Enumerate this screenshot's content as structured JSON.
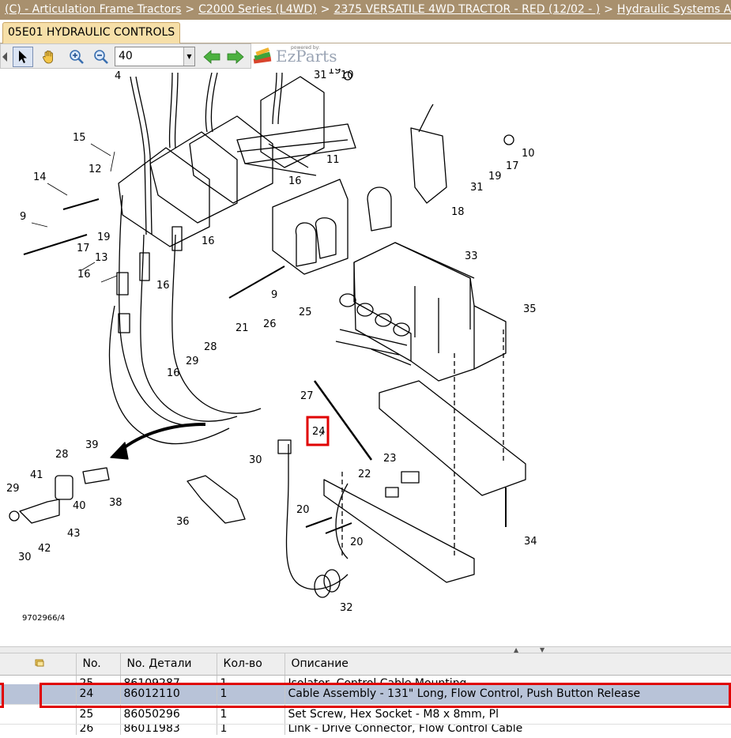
{
  "breadcrumb": {
    "items": [
      "(C) - Articulation Frame Tractors",
      "C2000 Series (L4WD)",
      "2375 VERSATILE 4WD TRACTOR - RED (12/02 - )",
      "Hydraulic Systems A"
    ],
    "separator": ">"
  },
  "tab": {
    "label": "05E01 HYDRAULIC CONTROLS"
  },
  "toolbar": {
    "zoom_value": "40",
    "buttons": [
      "scroll-left-icon",
      "select-arrow-icon",
      "pan-hand-icon",
      "zoom-in-icon",
      "zoom-out-icon",
      "back-arrow-icon",
      "forward-arrow-icon"
    ],
    "brand": "EzParts",
    "brand_small": "powered by:",
    "accent_green": "#3ea23a",
    "brand_color": "#9aa4b4"
  },
  "diagram": {
    "drawing_number": "9702966/4",
    "callouts": [
      "4",
      "10",
      "19",
      "31",
      "10",
      "11",
      "16",
      "12",
      "15",
      "14",
      "9",
      "19",
      "17",
      "13",
      "16",
      "16",
      "18",
      "19",
      "17",
      "31",
      "10",
      "16",
      "9",
      "21",
      "26",
      "25",
      "28",
      "29",
      "16",
      "27",
      "24",
      "33",
      "35",
      "39",
      "28",
      "41",
      "29",
      "40",
      "38",
      "36",
      "30",
      "30",
      "42",
      "43",
      "22",
      "23",
      "20",
      "20",
      "34",
      "32"
    ],
    "highlight_callout": "24",
    "highlight_color": "#e00000"
  },
  "parts_table": {
    "header": {
      "icon": "note-icon",
      "no": "No.",
      "part_no": "No. Детали",
      "qty": "Кол-во",
      "description": "Описание"
    },
    "rows": [
      {
        "no": "25",
        "part_no": "86109287",
        "qty": "1",
        "description": "Isolator, Control Cable Mounting"
      },
      {
        "no": "24",
        "part_no": "86012110",
        "qty": "1",
        "description": "Cable Assembly - 131\" Long, Flow Control, Push Button Release"
      },
      {
        "no": "25",
        "part_no": "86050296",
        "qty": "1",
        "description": "Set Screw, Hex Socket - M8 x 8mm, Pl"
      },
      {
        "no": "26",
        "part_no": "86011983",
        "qty": "1",
        "description": "Link - Drive Connector, Flow Control Cable"
      }
    ],
    "selected_row_color": "#b8c3d8"
  }
}
